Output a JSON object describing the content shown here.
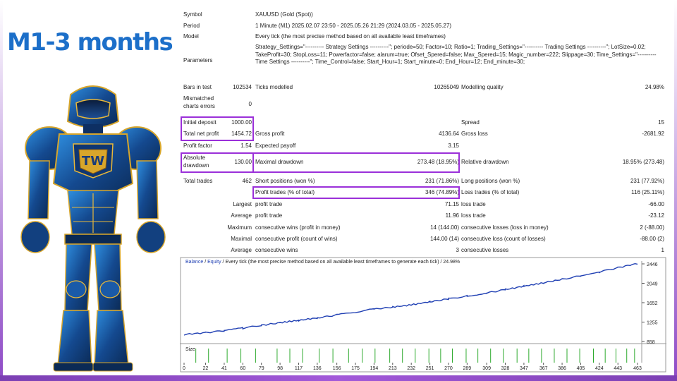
{
  "headline": "M1-3 months",
  "report": {
    "symbol_label": "Symbol",
    "symbol_value": "XAUUSD (Gold (Spot))",
    "period_label": "Period",
    "period_value": "1 Minute (M1) 2025.02.07 23:50 - 2025.05.26 21:29 (2024.03.05 - 2025.05.27)",
    "model_label": "Model",
    "model_value": "Every tick (the most precise method based on all available least timeframes)",
    "parameters_label": "Parameters",
    "parameters_value": "Strategy_Settings=\"---------- Strategy Settings ----------\"; periode=50; Factor=10; Ratio=1; Trading_Settings=\"---------- Trading Settings ----------\"; LotSize=0.02; TakeProfit=30; StopLoss=11; Powerfactor=false; alarum=true; Ofset_Spered=false; Max_Spered=15; Magic_number=222; Slippage=30; Time_Settings=\"---------- Time Settings ----------\"; Time_Control=false; Start_Hour=1; Start_minute=0; End_Hour=12; End_minute=30;",
    "bars_label": "Bars in test",
    "bars_value": "102534",
    "ticks_label": "Ticks modelled",
    "ticks_value": "10265049",
    "quality_label": "Modelling quality",
    "quality_value": "24.98%",
    "mismatch_label": "Mismatched charts errors",
    "mismatch_value": "0",
    "initial_deposit_label": "Initial deposit",
    "initial_deposit_value": "1000.00",
    "spread_label": "Spread",
    "spread_value": "15",
    "net_profit_label": "Total net profit",
    "net_profit_value": "1454.72",
    "gross_profit_label": "Gross profit",
    "gross_profit_value": "4136.64",
    "gross_loss_label": "Gross loss",
    "gross_loss_value": "-2681.92",
    "profit_factor_label": "Profit factor",
    "profit_factor_value": "1.54",
    "expected_payoff_label": "Expected payoff",
    "expected_payoff_value": "3.15",
    "abs_dd_label": "Absolute drawdown",
    "abs_dd_value": "130.00",
    "max_dd_label": "Maximal drawdown",
    "max_dd_value": "273.48 (18.95%)",
    "rel_dd_label": "Relative drawdown",
    "rel_dd_value": "18.95% (273.48)",
    "total_trades_label": "Total trades",
    "total_trades_value": "462",
    "short_label": "Short positions (won %)",
    "short_value": "231 (71.86%)",
    "long_label": "Long positions (won %)",
    "long_value": "231 (77.92%)",
    "profit_trades_label": "Profit trades (% of total)",
    "profit_trades_value": "346 (74.89%)",
    "loss_trades_label": "Loss trades (% of total)",
    "loss_trades_value": "116 (25.11%)",
    "largest_label": "Largest",
    "largest_profit_label": "profit trade",
    "largest_profit_value": "71.15",
    "largest_loss_label": "loss trade",
    "largest_loss_value": "-66.00",
    "average_label": "Average",
    "average_profit_label": "profit trade",
    "average_profit_value": "11.96",
    "average_loss_label": "loss trade",
    "average_loss_value": "-23.12",
    "maximum_label": "Maximum",
    "max_cons_wins_label": "consecutive wins (profit in money)",
    "max_cons_wins_value": "14 (144.00)",
    "max_cons_losses_label": "consecutive losses (loss in money)",
    "max_cons_losses_value": "2 (-88.00)",
    "maximal_label": "Maximal",
    "maximal_cons_profit_label": "consecutive profit (count of wins)",
    "maximal_cons_profit_value": "144.00 (14)",
    "maximal_cons_loss_label": "consecutive loss (count of losses)",
    "maximal_cons_loss_value": "-88.00 (2)",
    "average2_label": "Average",
    "avg_cons_wins_label": "consecutive wins",
    "avg_cons_wins_value": "3",
    "avg_cons_losses_label": "consecutive losses",
    "avg_cons_losses_value": "1"
  },
  "chart_legend": {
    "balance": "Balance",
    "sep": " / ",
    "equity": "Equity",
    "rest": " / Every tick (the most precise method based on all available least timeframes to generate each tick) / 24.98%"
  },
  "chart_data": {
    "type": "line",
    "series": [
      {
        "name": "Balance",
        "x": [
          0,
          22,
          41,
          60,
          79,
          98,
          117,
          136,
          156,
          175,
          194,
          213,
          232,
          251,
          270,
          289,
          309,
          328,
          347,
          367,
          386,
          405,
          424,
          443,
          463
        ],
        "values": [
          1000,
          1040,
          1080,
          1130,
          1190,
          1240,
          1290,
          1340,
          1400,
          1460,
          1520,
          1560,
          1610,
          1670,
          1730,
          1790,
          1850,
          1920,
          1990,
          2060,
          2130,
          2200,
          2280,
          2370,
          2454
        ]
      }
    ],
    "yticks": [
      2446,
      2049,
      1652,
      1255,
      858
    ],
    "ylim": [
      858,
      2446
    ],
    "xticks": [
      0,
      22,
      41,
      60,
      79,
      98,
      117,
      136,
      156,
      175,
      194,
      213,
      232,
      251,
      270,
      289,
      309,
      328,
      347,
      367,
      386,
      405,
      424,
      443,
      463
    ],
    "xlim": [
      0,
      463
    ],
    "size_label": "Size",
    "size_bars_x": [
      12,
      25,
      44,
      58,
      73,
      95,
      108,
      121,
      138,
      152,
      168,
      182,
      195,
      210,
      223,
      236,
      250,
      262,
      274,
      288,
      300,
      313,
      326,
      340,
      352,
      365,
      378,
      391,
      404,
      418,
      430,
      441,
      452,
      460
    ],
    "colors": {
      "balance": "#1f3fb3",
      "size": "#2eaa2e",
      "axis": "#555555"
    }
  }
}
